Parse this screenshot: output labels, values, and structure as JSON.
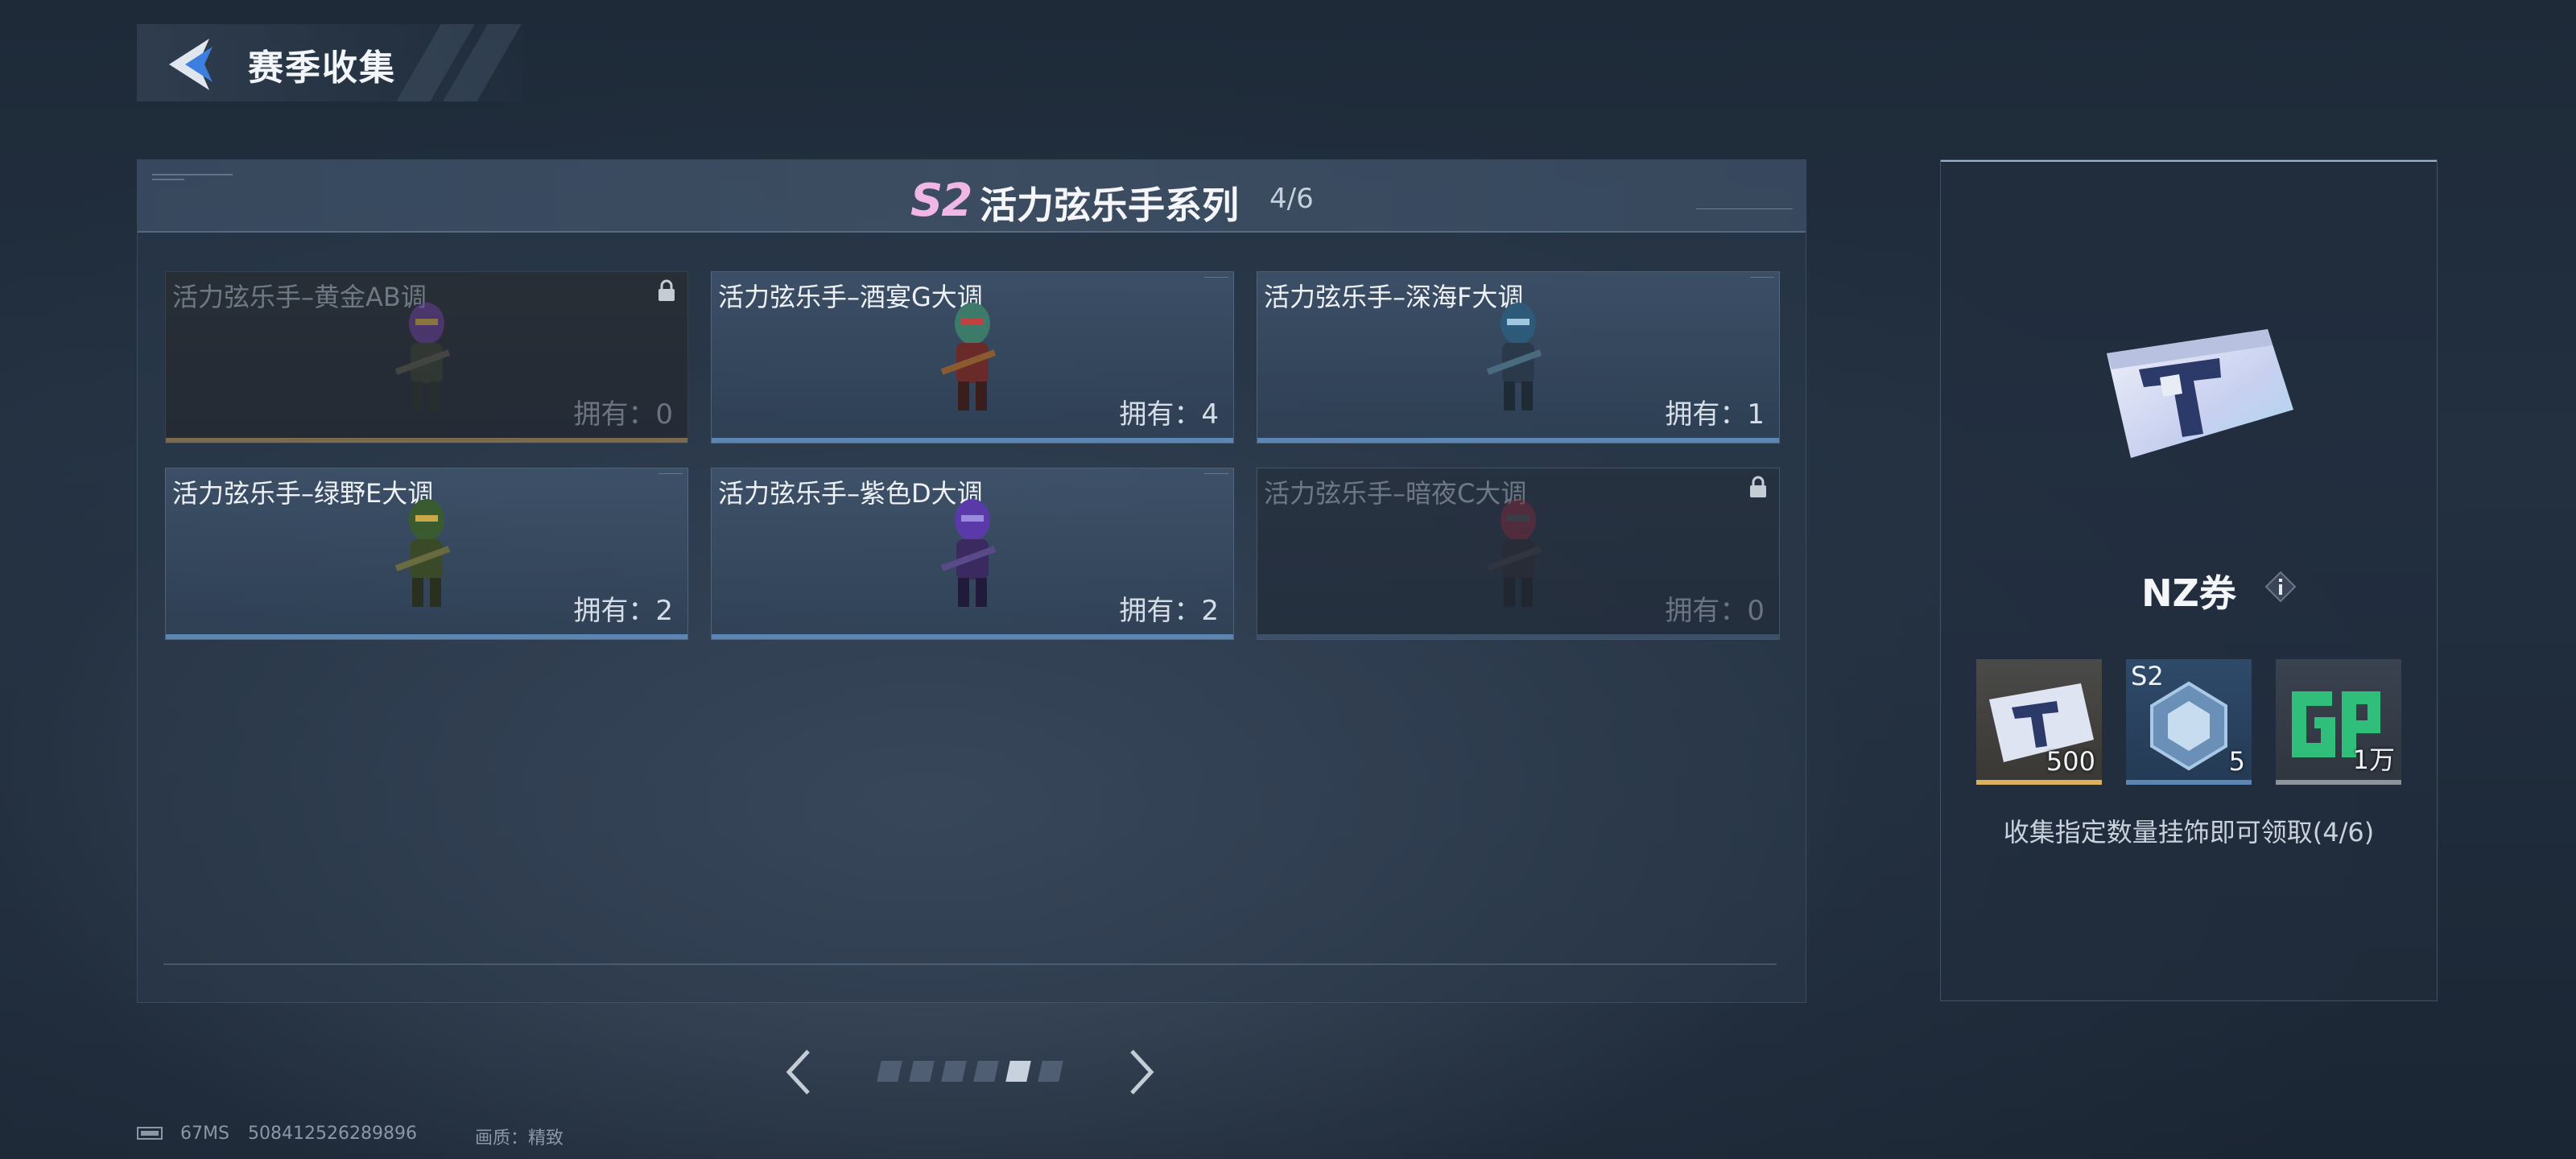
{
  "header": {
    "title": "赛季收集",
    "back_icon": "back-arrow-icon"
  },
  "series": {
    "badge": "S2",
    "title": "活力弦乐手系列",
    "progress": "4/6",
    "cards": [
      {
        "name": "活力弦乐手–黄金AB调",
        "owned": "拥有：0",
        "locked": true
      },
      {
        "name": "活力弦乐手–酒宴G大调",
        "owned": "拥有：4",
        "locked": false
      },
      {
        "name": "活力弦乐手–深海F大调",
        "owned": "拥有：1",
        "locked": false
      },
      {
        "name": "活力弦乐手–绿野E大调",
        "owned": "拥有：2",
        "locked": false
      },
      {
        "name": "活力弦乐手–紫色D大调",
        "owned": "拥有：2",
        "locked": false
      },
      {
        "name": "活力弦乐手–暗夜C大调",
        "owned": "拥有：0",
        "locked": true
      }
    ]
  },
  "pagination": {
    "total": 6,
    "active_index": 4
  },
  "reward": {
    "name": "NZ券",
    "info_icon": "info-icon",
    "items": [
      {
        "id": "nz-ticket",
        "qty": "500",
        "accent": "#d9b15a"
      },
      {
        "id": "s2-crystal",
        "label": "S2",
        "qty": "5",
        "accent": "#5b86b4"
      },
      {
        "id": "gp",
        "qty": "1万",
        "accent": "#8a939e"
      }
    ],
    "description": "收集指定数量挂饰即可领取(4/6)"
  },
  "footer": {
    "ping": "67MS",
    "uid": "508412526289896",
    "quality": "画质：精致"
  },
  "colors": {
    "accent_blue": "#5b86b4",
    "gold": "#d9b15a",
    "badge_pink": "#f0b6e6"
  }
}
